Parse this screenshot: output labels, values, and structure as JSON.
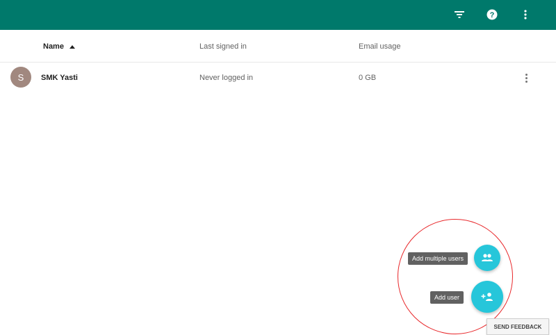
{
  "toolbar": {
    "icons": [
      "filter-icon",
      "help-icon",
      "more-vert-icon"
    ],
    "bg_color": "#00796b"
  },
  "table": {
    "columns": [
      {
        "label": "Name",
        "sorted": "ascending"
      },
      {
        "label": "Last signed in"
      },
      {
        "label": "Email usage"
      }
    ],
    "rows": [
      {
        "avatar_letter": "S",
        "name": "SMK Yasti",
        "last_signed_in": "Never logged in",
        "email_usage": "0 GB"
      }
    ]
  },
  "fab_menu": {
    "add_multiple_label": "Add multiple users",
    "add_user_label": "Add user",
    "accent_color": "#26c6da"
  },
  "feedback": {
    "label": "SEND FEEDBACK"
  }
}
